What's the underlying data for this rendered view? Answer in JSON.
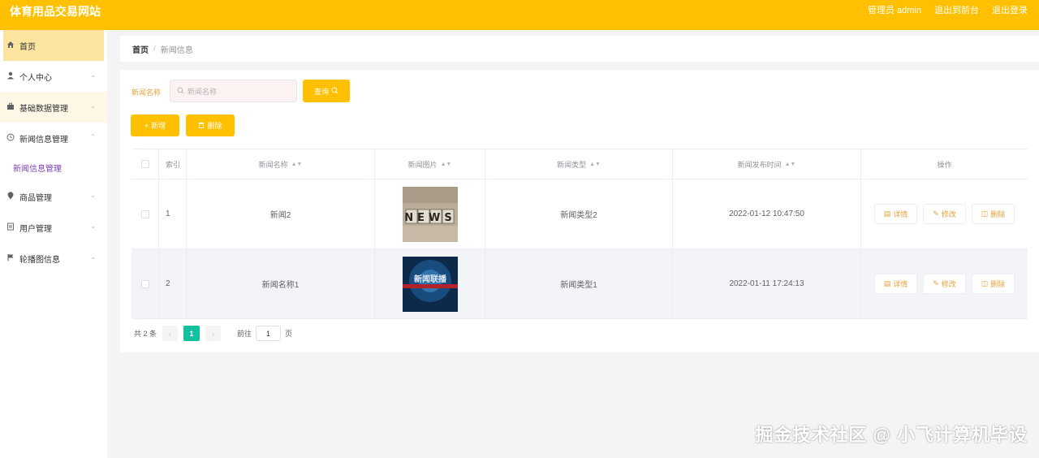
{
  "header": {
    "title": "体育用品交易网站",
    "admin": "管理员 admin",
    "front": "退出到前台",
    "logout": "退出登录"
  },
  "sidebar": {
    "items": [
      {
        "label": "首页",
        "icon": "home-icon"
      },
      {
        "label": "个人中心",
        "icon": "user-icon"
      },
      {
        "label": "基础数据管理",
        "icon": "briefcase-icon"
      },
      {
        "label": "新闻信息管理",
        "icon": "clock-icon"
      },
      {
        "label": "商品管理",
        "icon": "location-icon"
      },
      {
        "label": "用户管理",
        "icon": "document-icon"
      },
      {
        "label": "轮播图信息",
        "icon": "flag-icon"
      }
    ],
    "sub_item": "新闻信息管理"
  },
  "breadcrumb": {
    "home": "首页",
    "separator": "/",
    "current": "新闻信息"
  },
  "search": {
    "label": "新闻名称",
    "placeholder": "新闻名称",
    "query_label": "查询"
  },
  "actions": {
    "add_label": "新增",
    "delete_label": "删除"
  },
  "table": {
    "headers": {
      "index": "索引",
      "name": "新闻名称",
      "image": "新闻图片",
      "type": "新闻类型",
      "time": "新闻发布时间",
      "op": "操作"
    },
    "rows": [
      {
        "index": "1",
        "name": "新闻2",
        "type": "新闻类型2",
        "time": "2022-01-12 10:47:50",
        "image": "NEWS"
      },
      {
        "index": "2",
        "name": "新闻名称1",
        "type": "新闻类型1",
        "time": "2022-01-11 17:24:13",
        "image": "新闻联播"
      }
    ],
    "op_labels": {
      "detail": "详情",
      "edit": "修改",
      "delete": "删除"
    }
  },
  "pagination": {
    "total": "共 2 条",
    "current": "1",
    "goto_label": "前往",
    "page_value": "1",
    "page_suffix": "页"
  },
  "watermark": "掘金技术社区 @ 小飞计算机毕设",
  "colors": {
    "accent": "#ffc000",
    "page_active": "#13c0a0"
  }
}
